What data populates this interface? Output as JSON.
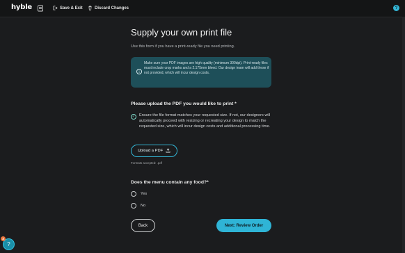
{
  "topbar": {
    "logo_main": "hyble",
    "save_exit_label": "Save & Exit",
    "discard_label": "Discard Changes",
    "help_glyph": "?"
  },
  "page": {
    "title": "Supply your own print file",
    "subtitle": "Use this form if you have a print-ready file you need printing.",
    "info_text": "Make sure your PDF images are high quality (minimum 300dpi). Print-ready files must include crop marks and a 2.175mm bleed. Our design team will add these if not provided, which will incur design costs.",
    "upload_heading": "Please upload the PDF you would like to print *",
    "check_text": "Ensure the file format matches your requested size. If not, our designers will automatically proceed with resizing or recreating your design to match the requested size, which will incur design costs and additional processing time.",
    "upload_button": "Upload a PDF",
    "formats_text": "Formats accepted: .pdf",
    "food_question": "Does the menu contain any food?*",
    "options": [
      {
        "label": "Yes"
      },
      {
        "label": "No"
      }
    ],
    "back_button": "Back",
    "next_button": "Next: Review Order"
  },
  "help_widget": {
    "badge_count": "3"
  },
  "icons": {
    "logo_dot": "#33c3e0",
    "accent": "#2fb4d6",
    "info_bg": "#1e4f59"
  }
}
